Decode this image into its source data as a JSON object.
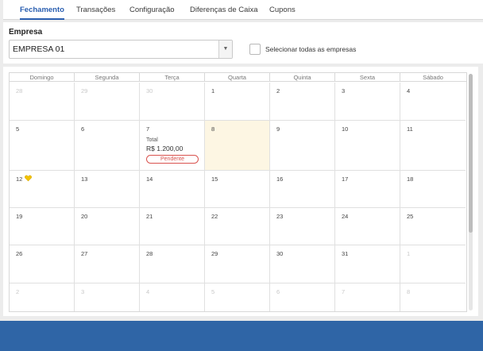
{
  "tabs": [
    {
      "label": "Fechamento",
      "active": true
    },
    {
      "label": "Transações",
      "active": false
    },
    {
      "label": "Configuração",
      "active": false
    },
    {
      "label": "Diferenças de Caixa",
      "active": false
    },
    {
      "label": "Cupons",
      "active": false
    }
  ],
  "filter": {
    "empresa_label": "Empresa",
    "empresa_value": "EMPRESA 01",
    "dropdown_icon": "caret-down-icon",
    "select_all_label": "Selecionar todas as empresas",
    "select_all_checked": false
  },
  "calendar": {
    "weekdays": [
      "Domingo",
      "Segunda",
      "Terça",
      "Quarta",
      "Quinta",
      "Sexta",
      "Sábado"
    ],
    "today": 8,
    "weeks": [
      [
        {
          "d": "28",
          "m": true
        },
        {
          "d": "29",
          "m": true
        },
        {
          "d": "30",
          "m": true
        },
        {
          "d": "1"
        },
        {
          "d": "2"
        },
        {
          "d": "3"
        },
        {
          "d": "4"
        }
      ],
      [
        {
          "d": "5"
        },
        {
          "d": "6"
        },
        {
          "d": "7",
          "event": {
            "label": "Total",
            "amount": "R$ 1.200,00",
            "status": "Pendente"
          }
        },
        {
          "d": "8",
          "today": true
        },
        {
          "d": "9"
        },
        {
          "d": "10"
        },
        {
          "d": "11"
        }
      ],
      [
        {
          "d": "12",
          "icon": "yellow-heart-icon"
        },
        {
          "d": "13"
        },
        {
          "d": "14"
        },
        {
          "d": "15"
        },
        {
          "d": "16"
        },
        {
          "d": "17"
        },
        {
          "d": "18"
        }
      ],
      [
        {
          "d": "19"
        },
        {
          "d": "20"
        },
        {
          "d": "21"
        },
        {
          "d": "22"
        },
        {
          "d": "23"
        },
        {
          "d": "24"
        },
        {
          "d": "25"
        }
      ],
      [
        {
          "d": "26"
        },
        {
          "d": "27"
        },
        {
          "d": "28"
        },
        {
          "d": "29"
        },
        {
          "d": "30"
        },
        {
          "d": "31"
        },
        {
          "d": "1",
          "m": true
        }
      ],
      [
        {
          "d": "2",
          "m": true
        },
        {
          "d": "3",
          "m": true
        },
        {
          "d": "4",
          "m": true
        },
        {
          "d": "5",
          "m": true
        },
        {
          "d": "6",
          "m": true
        },
        {
          "d": "7",
          "m": true
        },
        {
          "d": "8",
          "m": true
        }
      ]
    ]
  },
  "colors": {
    "accent": "#2b5fb0",
    "today_bg": "#fdf6e3",
    "pending": "#d9534f",
    "footer": "#2f65a6"
  }
}
